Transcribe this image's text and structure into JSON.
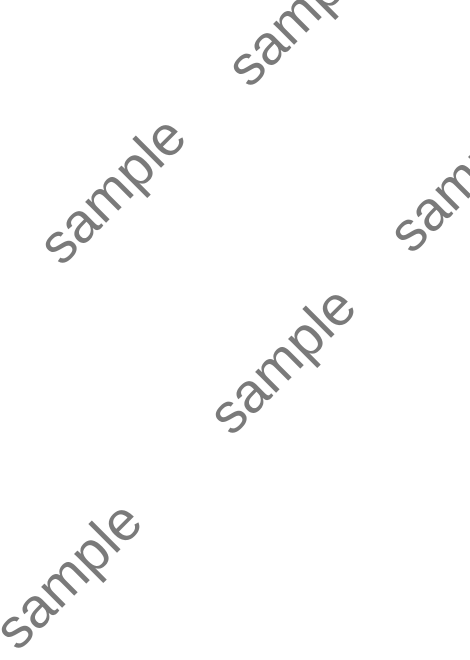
{
  "watermark": {
    "text": "sample",
    "color": "#7a7a7a"
  },
  "background_color": "#ffffff"
}
